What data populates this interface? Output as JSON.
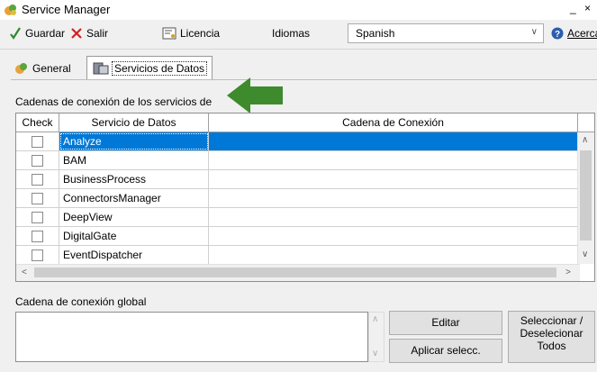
{
  "window": {
    "title": "Service Manager",
    "minimize": "_",
    "close": "×"
  },
  "toolbar": {
    "save_label": "Guardar",
    "exit_label": "Salir",
    "license_label": "Licencia",
    "language_label": "Idiomas",
    "language_value": "Spanish",
    "about_label": "Acerca"
  },
  "tabs": [
    {
      "label": "General"
    },
    {
      "label": "Servicios de Datos"
    }
  ],
  "services": {
    "section_label": "Cadenas de conexión de los servicios de",
    "columns": [
      "Check",
      "Servicio de Datos",
      "Cadena de Conexión"
    ],
    "rows": [
      {
        "name": "Analyze",
        "connection": "",
        "checked": false,
        "selected": true
      },
      {
        "name": "BAM",
        "connection": "",
        "checked": false,
        "selected": false
      },
      {
        "name": "BusinessProcess",
        "connection": "",
        "checked": false,
        "selected": false
      },
      {
        "name": "ConnectorsManager",
        "connection": "",
        "checked": false,
        "selected": false
      },
      {
        "name": "DeepView",
        "connection": "",
        "checked": false,
        "selected": false
      },
      {
        "name": "DigitalGate",
        "connection": "",
        "checked": false,
        "selected": false
      },
      {
        "name": "EventDispatcher",
        "connection": "",
        "checked": false,
        "selected": false
      }
    ]
  },
  "global": {
    "label": "Cadena de conexión global",
    "value": "",
    "edit_button": "Editar",
    "apply_button": "Aplicar selecc.",
    "toggle_all_button": "Seleccionar / Deselecionar Todos"
  },
  "colors": {
    "selection": "#0078d7",
    "arrow": "#3d8b2d",
    "exit_red": "#d02020",
    "save_green": "#2a8a2a"
  }
}
